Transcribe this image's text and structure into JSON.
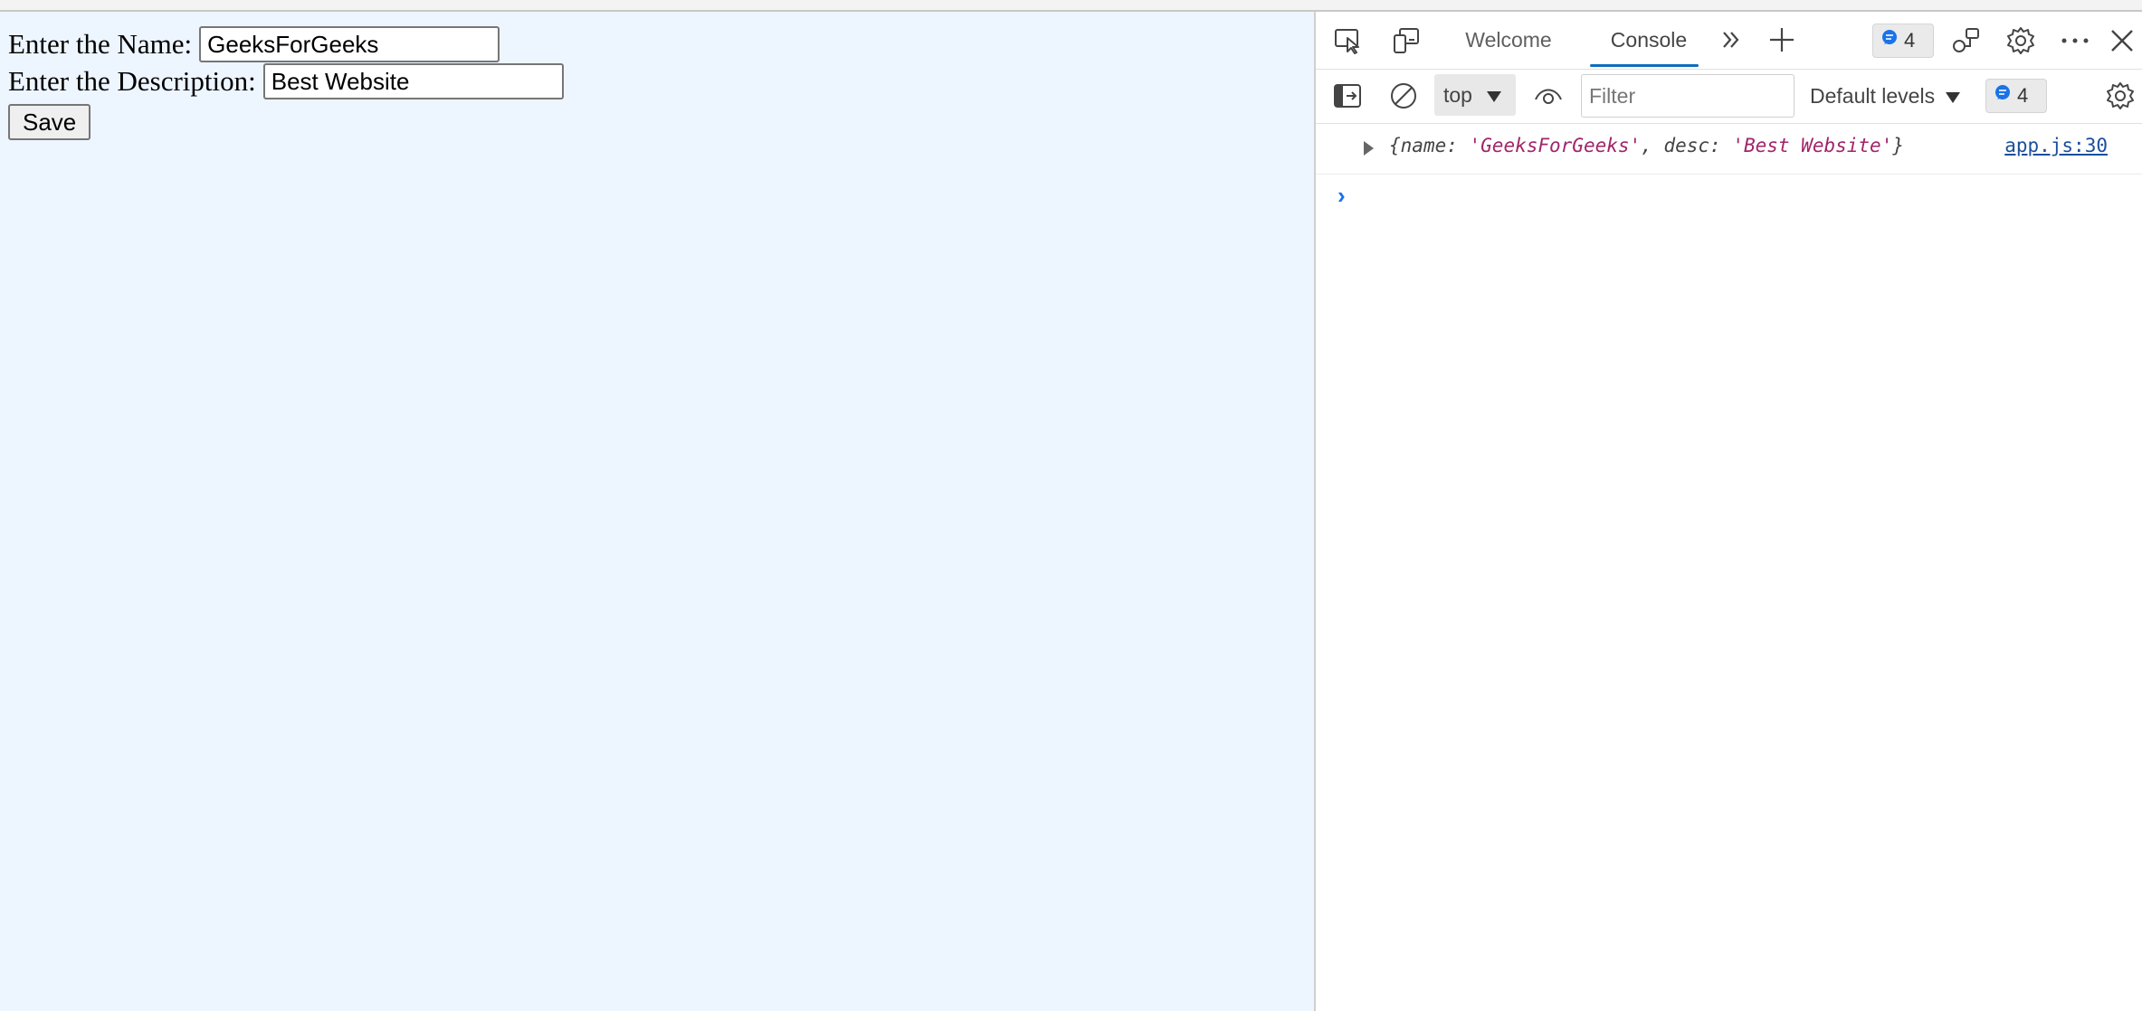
{
  "page": {
    "name_label": "Enter the Name:",
    "name_value": "GeeksForGeeks",
    "desc_label": "Enter the Description:",
    "desc_value": "Best Website",
    "save_label": "Save"
  },
  "devtools": {
    "tabs": [
      {
        "label": "Welcome",
        "active": false
      },
      {
        "label": "Console",
        "active": true
      }
    ],
    "issues_count": "4",
    "context": "top",
    "filter_placeholder": "Filter",
    "levels_label": "Default levels",
    "messages_count": "4",
    "log": {
      "open": "{",
      "k1": "name: ",
      "v1": "'GeeksForGeeks'",
      "sep": ", ",
      "k2": "desc: ",
      "v2": "'Best Website'",
      "close": "}",
      "source": "app.js:30"
    },
    "prompt": "›"
  },
  "colors": {
    "page_background": "#edf5ff",
    "accent": "#0f6cbd",
    "string_value": "#a0256a",
    "link": "#1a4f9c"
  }
}
